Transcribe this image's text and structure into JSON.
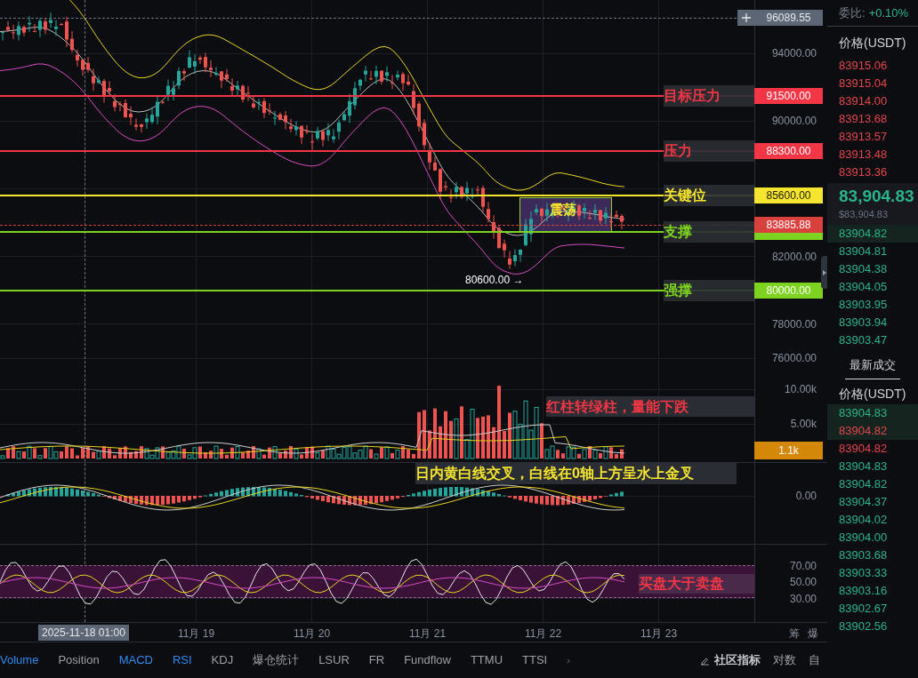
{
  "chart": {
    "top_tag": {
      "price": "96089.55"
    },
    "price_ticks": [
      "94000.00",
      "90000.00",
      "82000.00",
      "78000.00",
      "76000.00"
    ],
    "levels": [
      {
        "label": "目标压力",
        "price": "91500.00",
        "color": "#f23645"
      },
      {
        "label": "压力",
        "price": "88300.00",
        "color": "#f23645"
      },
      {
        "label": "关键位",
        "price": "85600.00",
        "color": "#f5e52e"
      },
      {
        "label": "支撑",
        "color": "#7ed321"
      },
      {
        "label": "强撑",
        "price": "80000.00",
        "color": "#7ed321"
      }
    ],
    "current_price": "83885.88",
    "range_box": {
      "label": "震荡"
    },
    "low_marker": {
      "label": "80600.00 →"
    },
    "volume": {
      "ticks": [
        "10.00k",
        "5.00k"
      ],
      "tag": "1.1k",
      "note": "红柱转绿柱，量能下跌"
    },
    "macd": {
      "ticks": [
        "0.00"
      ],
      "note": "日内黄白线交叉，白线在0轴上方呈水上金叉"
    },
    "rsi": {
      "ticks": [
        "70.00",
        "50.00",
        "30.00"
      ],
      "note": "买盘大于卖盘"
    },
    "time_axis": {
      "cursor": "2025-11-18 01:00",
      "labels": [
        "11月 19",
        "11月 20",
        "11月 21",
        "11月 22",
        "11月 23"
      ],
      "right": [
        "筹",
        "爆"
      ]
    }
  },
  "indicator_tabs": [
    {
      "label": "Volume",
      "selected": true
    },
    {
      "label": "Position",
      "selected": false
    },
    {
      "label": "MACD",
      "selected": true
    },
    {
      "label": "RSI",
      "selected": true
    },
    {
      "label": "KDJ",
      "selected": false
    },
    {
      "label": "爆仓统计",
      "selected": false
    },
    {
      "label": "LSUR",
      "selected": false
    },
    {
      "label": "FR",
      "selected": false
    },
    {
      "label": "Fundflow",
      "selected": false
    },
    {
      "label": "TTMU",
      "selected": false
    },
    {
      "label": "TTSI",
      "selected": false
    }
  ],
  "more": "›",
  "toolbar_right": {
    "community": "社区指标",
    "log": "对数",
    "auto": "自"
  },
  "order_book": {
    "ratio_label": "委比:",
    "ratio": "+0.10%",
    "header": "价格(USDT)",
    "asks": [
      "83915.06",
      "83915.04",
      "83914.00",
      "83913.68",
      "83913.57",
      "83913.48",
      "83913.36"
    ],
    "last_price": "83,904.83",
    "last_price_usd": "$83,904.83",
    "bids": [
      "83904.82",
      "83904.81",
      "83904.38",
      "83904.05",
      "83903.95",
      "83903.94",
      "83903.47"
    ]
  },
  "trades": {
    "title": "最新成交",
    "header": "价格(USDT)",
    "rows": [
      {
        "price": "83904.83",
        "color": "#2bb38a"
      },
      {
        "price": "83904.82",
        "color": "#e0474c"
      },
      {
        "price": "83904.82",
        "color": "#e0474c"
      },
      {
        "price": "83904.83",
        "color": "#2bb38a"
      },
      {
        "price": "83904.82",
        "color": "#2bb38a"
      },
      {
        "price": "83904.37",
        "color": "#2bb38a"
      },
      {
        "price": "83904.02",
        "color": "#2bb38a"
      },
      {
        "price": "83904.00",
        "color": "#2bb38a"
      },
      {
        "price": "83903.68",
        "color": "#2bb38a"
      },
      {
        "price": "83903.33",
        "color": "#2bb38a"
      },
      {
        "price": "83903.16",
        "color": "#2bb38a"
      },
      {
        "price": "83902.67",
        "color": "#2bb38a"
      },
      {
        "price": "83902.56",
        "color": "#2bb38a"
      }
    ]
  }
}
